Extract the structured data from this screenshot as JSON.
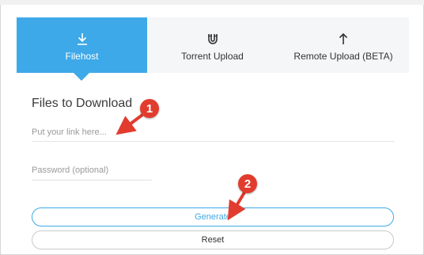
{
  "tabs": [
    {
      "label": "Filehost",
      "icon": "download-icon",
      "active": true
    },
    {
      "label": "Torrent Upload",
      "icon": "magnet-icon",
      "active": false
    },
    {
      "label": "Remote Upload (BETA)",
      "icon": "upload-icon",
      "active": false
    }
  ],
  "form": {
    "heading": "Files to Download",
    "link_placeholder": "Put your link here...",
    "password_placeholder": "Password (optional)",
    "generate_label": "Generate",
    "reset_label": "Reset"
  },
  "annotations": {
    "marker_1": "1",
    "marker_2": "2"
  },
  "colors": {
    "accent": "#3da9e8",
    "tab_bar_bg": "#f4f6f8",
    "marker": "#e23c2e"
  }
}
